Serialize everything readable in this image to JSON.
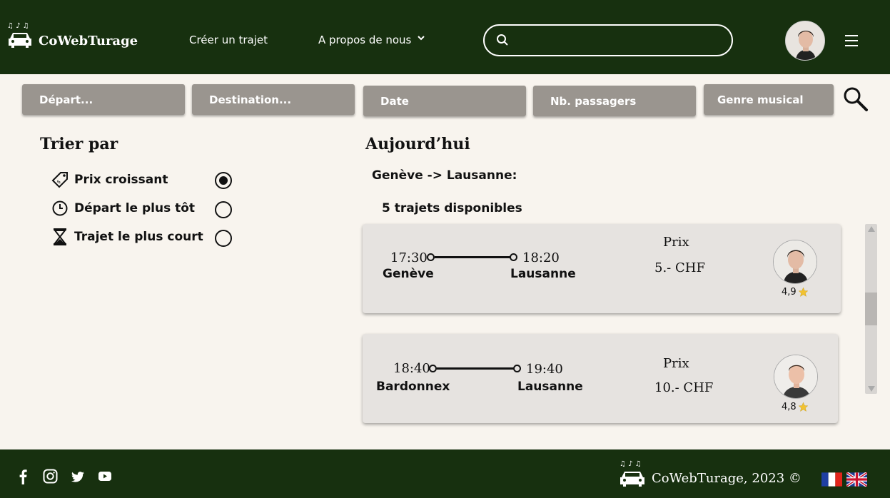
{
  "header": {
    "brand": "CoWebTurage",
    "nav": {
      "create": "Créer un trajet",
      "about": "A propos de nous"
    },
    "search": {
      "placeholder": ""
    }
  },
  "filters": {
    "depart": "Départ...",
    "destination": "Destination...",
    "date": "Date",
    "passengers": "Nb. passagers",
    "genre": "Genre musical"
  },
  "sort": {
    "title": "Trier par",
    "options": [
      {
        "label": "Prix croissant",
        "icon": "price-tag-icon",
        "selected": true
      },
      {
        "label": "Départ le plus tôt",
        "icon": "clock-icon",
        "selected": false
      },
      {
        "label": "Trajet le plus court",
        "icon": "hourglass-icon",
        "selected": false
      }
    ]
  },
  "results": {
    "title": "Aujourd’hui",
    "route": "Genève -> Lausanne:",
    "count": "5 trajets disponibles",
    "trips": [
      {
        "dep_time": "17:30",
        "arr_time": "18:20",
        "dep_city": "Genève",
        "arr_city": "Lausanne",
        "price_label": "Prix",
        "price": "5.- CHF",
        "rating": "4,9"
      },
      {
        "dep_time": "18:40",
        "arr_time": "19:40",
        "dep_city": "Bardonnex",
        "arr_city": "Lausanne",
        "price_label": "Prix",
        "price": "10.- CHF",
        "rating": "4,8"
      }
    ]
  },
  "footer": {
    "copyright": "CoWebTurage, 2023 ©",
    "social": [
      "facebook-icon",
      "instagram-icon",
      "twitter-icon",
      "youtube-icon"
    ],
    "languages": [
      "fr",
      "en"
    ]
  },
  "colors": {
    "primary": "#17300f",
    "background": "#f8f4ee",
    "filter": "#9a958f",
    "card": "#e6e3e0",
    "star": "#f2c230"
  }
}
